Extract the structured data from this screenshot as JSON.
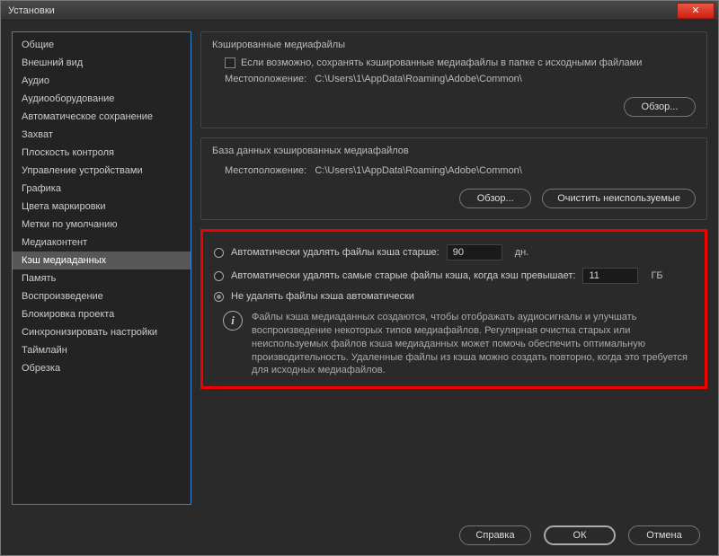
{
  "window": {
    "title": "Установки"
  },
  "sidebar": {
    "items": [
      "Общие",
      "Внешний вид",
      "Аудио",
      "Аудиооборудование",
      "Автоматическое сохранение",
      "Захват",
      "Плоскость контроля",
      "Управление устройствами",
      "Графика",
      "Цвета маркировки",
      "Метки по умолчанию",
      "Медиаконтент",
      "Кэш медиаданных",
      "Память",
      "Воспроизведение",
      "Блокировка проекта",
      "Синхронизировать настройки",
      "Таймлайн",
      "Обрезка"
    ],
    "selected_index": 12
  },
  "cached": {
    "title": "Кэшированные медиафайлы",
    "checkbox_label": "Если возможно, сохранять кэшированные медиафайлы в папке с исходными файлами",
    "location_label": "Местоположение:",
    "location_value": "C:\\Users\\1\\AppData\\Roaming\\Adobe\\Common\\",
    "browse": "Обзор..."
  },
  "db": {
    "title": "База данных кэшированных медиафайлов",
    "location_label": "Местоположение:",
    "location_value": "C:\\Users\\1\\AppData\\Roaming\\Adobe\\Common\\",
    "browse": "Обзор...",
    "clean": "Очистить неиспользуемые"
  },
  "cleanup": {
    "opt1": "Автоматически удалять файлы кэша старше:",
    "val1": "90",
    "unit1": "дн.",
    "opt2": "Автоматически удалять самые старые файлы кэша, когда кэш превышает:",
    "val2": "11",
    "unit2": "ГБ",
    "opt3": "Не удалять файлы кэша автоматически",
    "info": "Файлы кэша медиаданных создаются, чтобы отображать аудиосигналы и улучшать воспроизведение некоторых типов медиафайлов. Регулярная очистка старых или неиспользуемых файлов кэша медиаданных может помочь обеспечить оптимальную производительность. Удаленные файлы из кэша можно создать повторно, когда это требуется для исходных медиафайлов."
  },
  "footer": {
    "help": "Справка",
    "ok": "ОК",
    "cancel": "Отмена"
  }
}
